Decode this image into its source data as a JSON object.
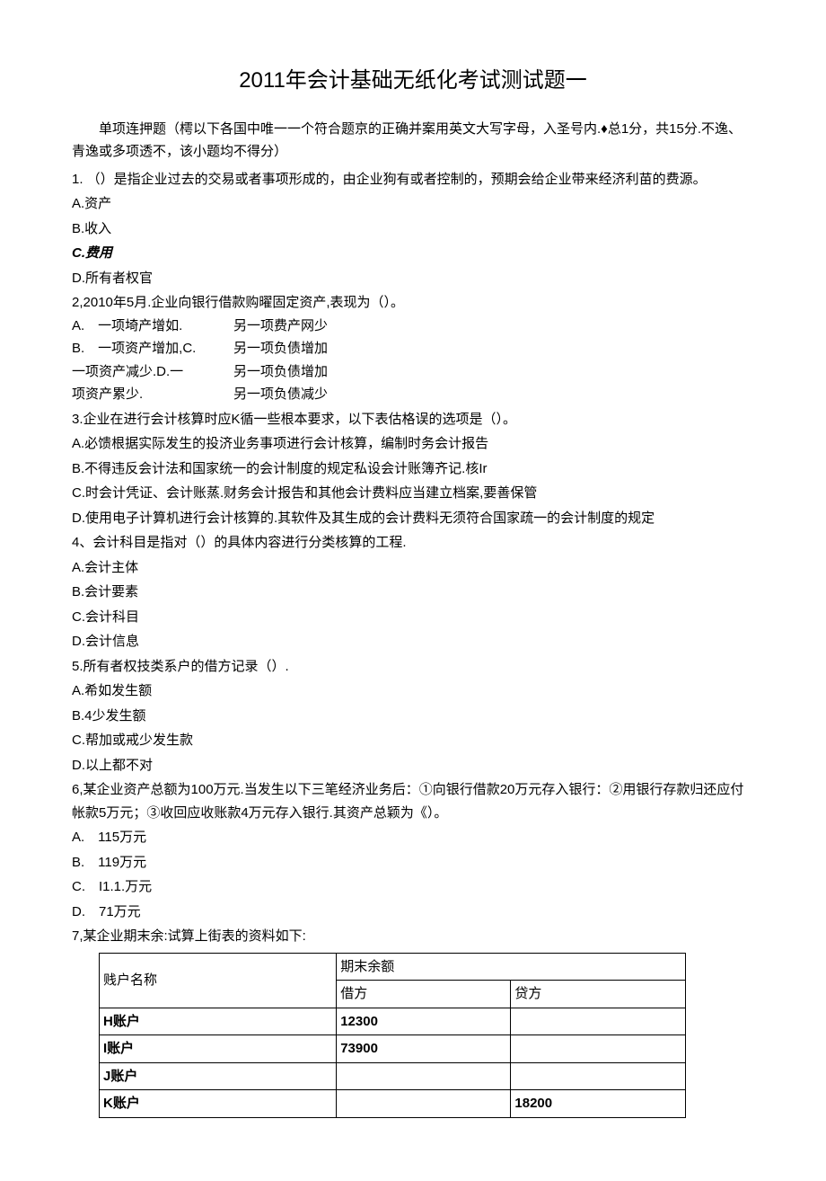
{
  "title": "2011年会计基础无纸化考试测试题一",
  "intro": "单项连押题（樗以下各国中唯一一个符合题京的正确并案用英文大写字母，入圣号内.♦总1分，共15分.不逸、青逸或多项透不，该小题均不得分）",
  "q1": {
    "text": "1. （）是指企业过去的交易或者事项形成的，由企业狗有或者控制的，预期会给企业带来经济利苗的费源。",
    "a": "A.资产",
    "b": "B.收入",
    "c": "C.费用",
    "d": "D.所有者权官"
  },
  "q2": {
    "text": "2,2010年5月.企业向银行借款购曜固定资产,表现为（）。",
    "a1": "A.　一项埼产增如.",
    "a2": "另一项费产网少",
    "b1": "B.　一项资产增加,C.",
    "b2": "另一项负债增加",
    "c1": "一项资产减少.D.一",
    "c2": "另一项负债增加",
    "d1": "项资产累少.",
    "d2": "另一项负债减少"
  },
  "q3": {
    "text": "3.企业在进行会计核算时应K循一些根本要求，以下表估格误的选项是（）。",
    "a": "A.必馈根据实际发生的投济业务事项进行会计核算，编制时务会计报告",
    "b": "B.不得违反会计法和国家统一的会计制度的规定私设会计账簿齐记.核Ir",
    "c": "C.时会计凭证、会计账蒸.财务会计报告和其他会计费料应当建立档案,要善保管",
    "d": "D.使用电子计算机进行会计核算的.其软件及其生成的会计费料无须符合国家疏一的会计制度的规定"
  },
  "q4": {
    "text": "4、会计科目是指对（）的具体内容进行分类核算的工程.",
    "a": "A.会计主体",
    "b": "B.会计要素",
    "c": "C.会计科目",
    "d": "D.会计信息"
  },
  "q5": {
    "text": "5.所有者权技类系户的借方记录（）.",
    "a": "A.希如发生额",
    "b": "B.4少发生额",
    "c": "C.帮加或戒少发生款",
    "d": "D.以上都不对"
  },
  "q6": {
    "text": "6,某企业资产总额为100万元.当发生以下三笔经济业务后：①向银行借款20万元存入银行：②用银行存款归还应付帐款5万元；③收回应收账款4万元存入银行.其资产总颖为《）。",
    "a": "A.　115万元",
    "b": "B.　119万元",
    "c": "C.　I1.1.万元",
    "d": "D.　71万元"
  },
  "q7": {
    "text": "7,某企业期末余:试算上街表的资料如下:"
  },
  "table": {
    "header": {
      "name": "贱户名称",
      "balance": "期末余额",
      "debit": "借方",
      "credit": "贷方"
    },
    "rows": [
      {
        "name": "H账户",
        "debit": "12300",
        "credit": ""
      },
      {
        "name": "I账户",
        "debit": "73900",
        "credit": ""
      },
      {
        "name": "J账户",
        "debit": "",
        "credit": ""
      },
      {
        "name": "K账户",
        "debit": "",
        "credit": "18200"
      }
    ]
  }
}
